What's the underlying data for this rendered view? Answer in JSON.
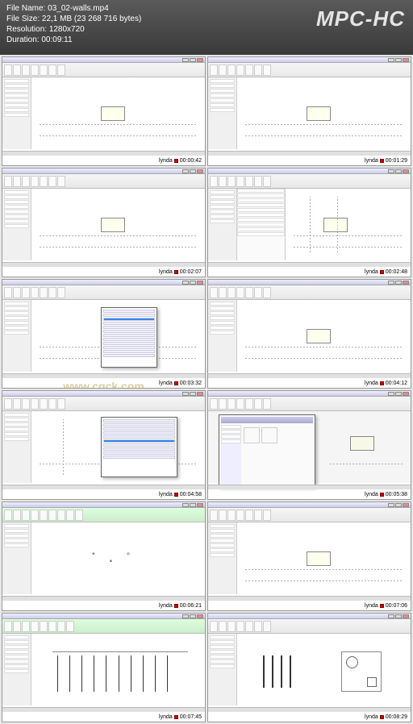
{
  "header": {
    "file_name_label": "File Name:",
    "file_name_value": "03_02-walls.mp4",
    "file_size_label": "File Size:",
    "file_size_value": "22,1 MB (23 268 716 bytes)",
    "resolution_label": "Resolution:",
    "resolution_value": "1280x720",
    "duration_label": "Duration:",
    "duration_value": "00:09:11",
    "app_title": "MPC-HC"
  },
  "watermark": "www.cgck.com",
  "thumbs": [
    {
      "brand": "lynda",
      "time": "00:00:42"
    },
    {
      "brand": "lynda",
      "time": "00:01:29"
    },
    {
      "brand": "lynda",
      "time": "00:02:07"
    },
    {
      "brand": "lynda",
      "time": "00:02:48"
    },
    {
      "brand": "lynda",
      "time": "00:03:32"
    },
    {
      "brand": "lynda",
      "time": "00:04:12"
    },
    {
      "brand": "lynda",
      "time": "00:04:58"
    },
    {
      "brand": "lynda",
      "time": "00:05:38"
    },
    {
      "brand": "lynda",
      "time": "00:06:21"
    },
    {
      "brand": "lynda",
      "time": "00:07:06"
    },
    {
      "brand": "lynda",
      "time": "00:07:45"
    },
    {
      "brand": "lynda",
      "time": "00:08:29"
    }
  ]
}
